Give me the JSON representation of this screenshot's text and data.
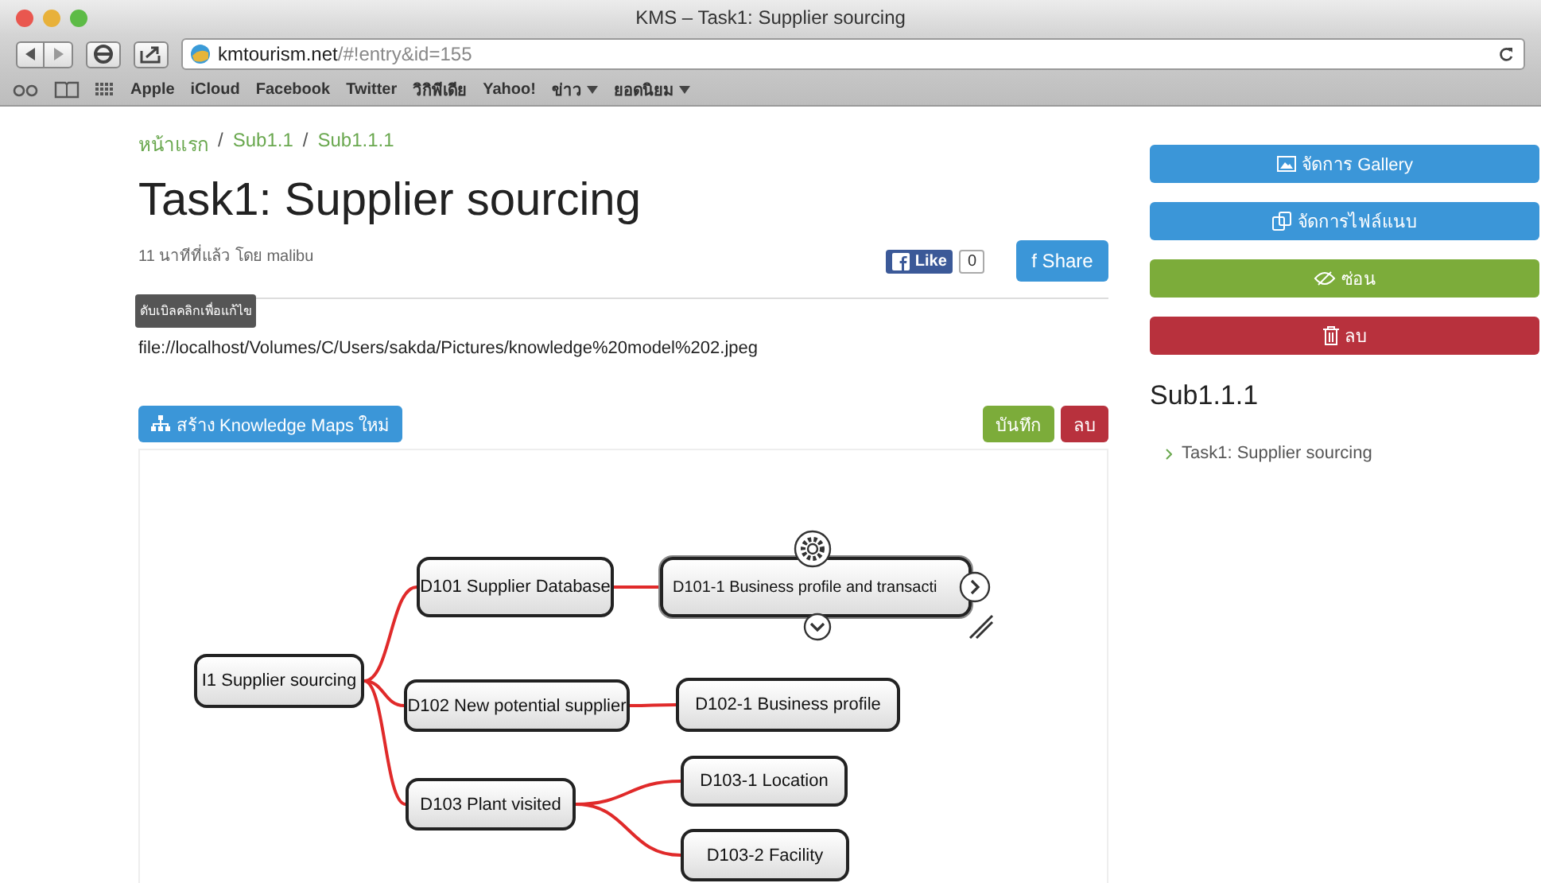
{
  "window": {
    "title": "KMS – Task1: Supplier sourcing"
  },
  "address_bar": {
    "domain": "kmtourism.net",
    "path": "/#!entry&id=155"
  },
  "bookmarks": [
    {
      "label": "Apple",
      "kind": "link"
    },
    {
      "label": "iCloud",
      "kind": "link"
    },
    {
      "label": "Facebook",
      "kind": "link"
    },
    {
      "label": "Twitter",
      "kind": "link"
    },
    {
      "label": "วิกิพีเดีย",
      "kind": "link"
    },
    {
      "label": "Yahoo!",
      "kind": "link"
    },
    {
      "label": "ข่าว",
      "kind": "menu"
    },
    {
      "label": "ยอดนิยม",
      "kind": "menu"
    }
  ],
  "breadcrumb": [
    "หน้าแรก",
    "Sub1.1",
    "Sub1.1.1"
  ],
  "breadcrumb_separator": "/",
  "title": "Task1: Supplier sourcing",
  "meta": "11 นาทีที่แล้ว โดย malibu",
  "like": {
    "label": "Like",
    "count": "0"
  },
  "share_icon": "f",
  "share": "Share",
  "tooltip": "ดับเบิลคลิกเพื่อแก้ไข",
  "file_path": "file://localhost/Volumes/C/Users/sakda/Pictures/knowledge%20model%202.jpeg",
  "create_button": "สร้าง Knowledge Maps ใหม่",
  "save_button": "บันทึก",
  "delete_button": "ลบ",
  "mind_map": {
    "label": "I1 Supplier sourcing",
    "selected": false,
    "children": [
      {
        "label": "D101 Supplier Database",
        "selected": false,
        "children": [
          {
            "label": "D101-1 Business profile and transacti",
            "selected": true
          }
        ]
      },
      {
        "label": "D102 New potential supplier",
        "selected": false,
        "children": [
          {
            "label": "D102-1 Business profile",
            "selected": false
          }
        ]
      },
      {
        "label": "D103 Plant visited",
        "selected": false,
        "children": [
          {
            "label": "D103-1 Location",
            "selected": false
          },
          {
            "label": "D103-2 Facility",
            "selected": false
          }
        ]
      }
    ]
  },
  "side_buttons": [
    {
      "label": "จัดการ Gallery",
      "kind": "gallery"
    },
    {
      "label": "จัดการไฟล์แนบ",
      "kind": "files"
    },
    {
      "label": "ซ่อน",
      "kind": "hide"
    },
    {
      "label": "ลบ",
      "kind": "delete"
    }
  ],
  "side_heading": "Sub1.1.1",
  "side_items": [
    "Task1: Supplier sourcing"
  ]
}
